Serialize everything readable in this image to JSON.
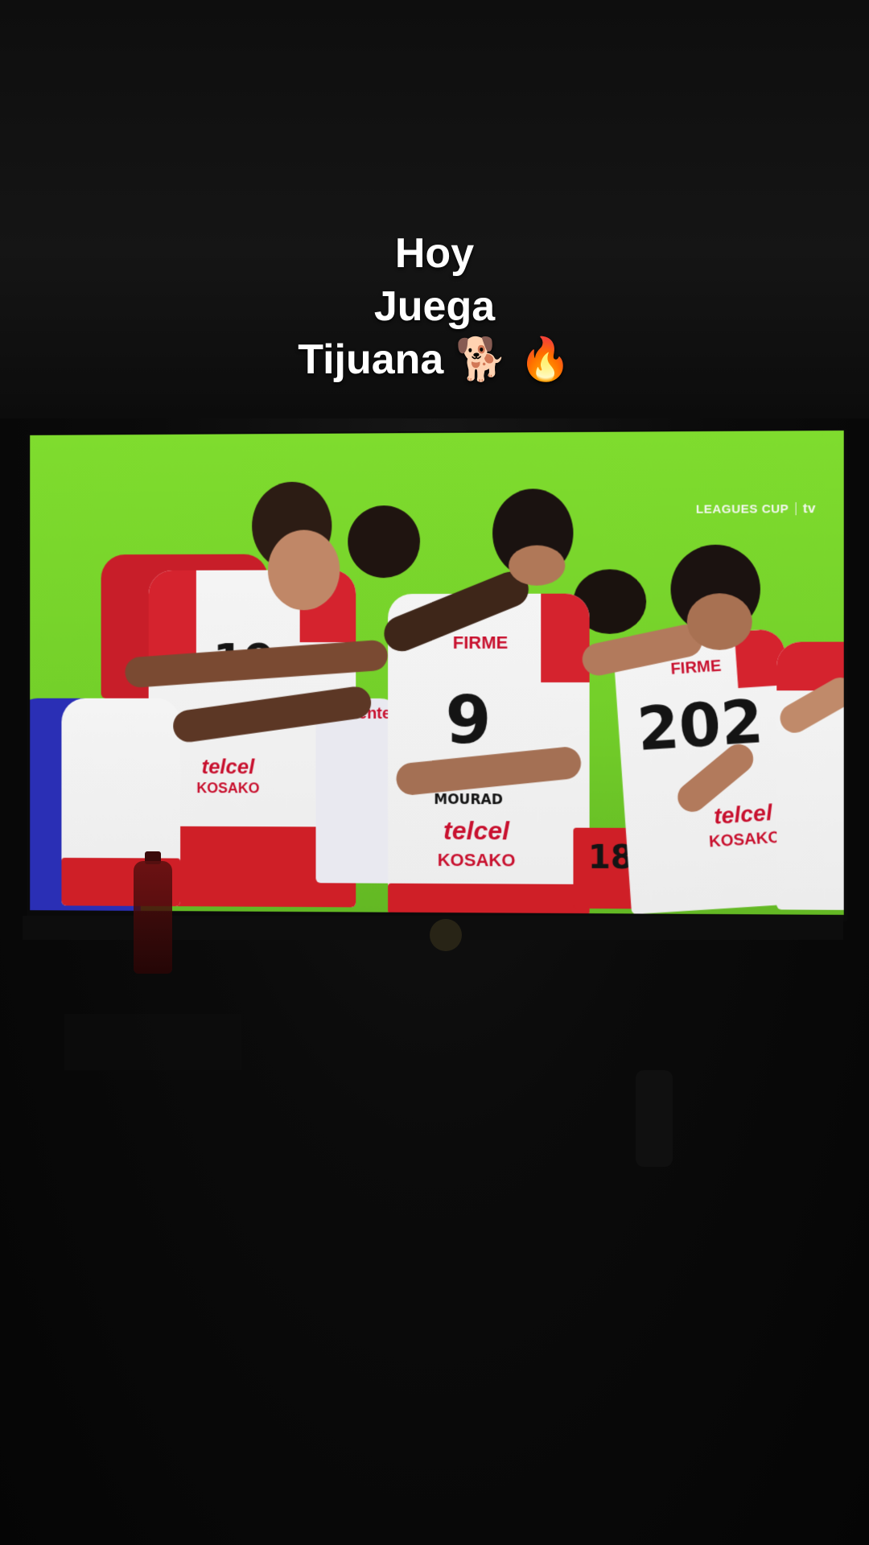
{
  "caption": {
    "line1": "Hoy",
    "line2": "Juega",
    "line3": "Tijuana 🐕 🔥"
  },
  "broadcast": {
    "league_logo": "LEAGUES CUP",
    "network_logo": " tv"
  },
  "jerseys": [
    {
      "number": "19",
      "sponsor": "Caliente"
    },
    {
      "number": "9",
      "sponsor_top": "FIRME",
      "name": "MOURAD",
      "sponsor": "telcel",
      "sponsor2": "KOSAKO"
    },
    {
      "number": "202",
      "sponsor_top": "FIRME",
      "sponsor": "telcel",
      "sponsor2": "KOSAKO"
    },
    {
      "number": "188"
    },
    {
      "sponsor": "telcel",
      "sponsor2": "KOSAKO"
    }
  ],
  "colors": {
    "pitch": "#74d02a",
    "jersey_red": "#d5232e",
    "jersey_white": "#f2f2f2"
  }
}
